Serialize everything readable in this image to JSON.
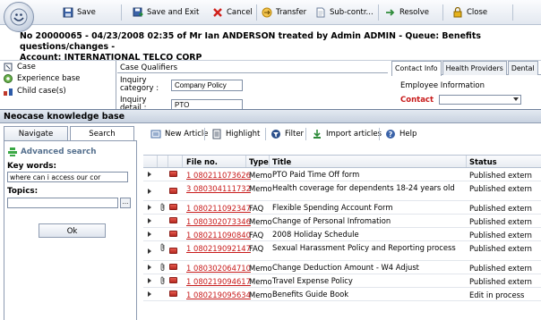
{
  "toolbar": {
    "save": "Save",
    "save_exit": "Save and Exit",
    "cancel": "Cancel",
    "transfer": "Transfer",
    "subcontr": "Sub-contr...",
    "resolve": "Resolve",
    "close": "Close"
  },
  "header": {
    "line1": "No 20000065 - 04/23/2008 02:35 of Mr Ian ANDERSON treated by Admin ADMIN - Queue: Benefits questions/changes -",
    "line2": "Account: INTERNATIONAL TELCO CORP"
  },
  "case_nav": [
    "Case",
    "Experience base",
    "Child case(s)"
  ],
  "qualifiers": {
    "title": "Case Qualifiers",
    "inquiry_category_label": "Inquiry category :",
    "inquiry_category_value": "Company Policy",
    "inquiry_detail_label": "Inquiry detail :",
    "inquiry_detail_value": "PTO"
  },
  "contact_panel": {
    "tabs": [
      "Contact Info",
      "Health Providers",
      "Dental"
    ],
    "section": "Employee Information",
    "contact_label": "Contact"
  },
  "kb": {
    "title": "Neocase knowledge base",
    "tabs": {
      "navigate": "Navigate",
      "search": "Search"
    },
    "advanced_search": "Advanced search",
    "keywords_label": "Key words:",
    "keywords_value": "where can i access our cor",
    "topics_label": "Topics:",
    "topics_btn": "...",
    "ok": "Ok"
  },
  "grid_toolbar": {
    "new_article": "New Article",
    "highlight": "Highlight",
    "filter": "Filter",
    "import": "Import articles",
    "help": "Help"
  },
  "columns": {
    "file_no": "File no.",
    "type": "Type",
    "title": "Title",
    "status": "Status"
  },
  "rows": [
    {
      "file_no": "1 080211073626",
      "type": "Memo",
      "title": "PTO Paid Time Off form",
      "status": "Published extern",
      "attach": false
    },
    {
      "file_no": "3 080304111732",
      "type": "Memo",
      "title": "Health coverage for dependents 18-24 years old",
      "status": "Published extern",
      "attach": false
    },
    {
      "file_no": "1 080211092347",
      "type": "FAQ",
      "title": "Flexible Spending Account Form",
      "status": "Published extern",
      "attach": true
    },
    {
      "file_no": "1 080302073346",
      "type": "Memo",
      "title": "Change of Personal Infromation",
      "status": "Published extern",
      "attach": false
    },
    {
      "file_no": "1 080211090840",
      "type": "FAQ",
      "title": "2008 Holiday Schedule",
      "status": "Published extern",
      "attach": false
    },
    {
      "file_no": "1 080219092147",
      "type": "FAQ",
      "title": "Sexual Harassment Policy and Reporting process",
      "status": "Published extern",
      "attach": true
    },
    {
      "file_no": "1 080302064710",
      "type": "Memo",
      "title": "Change Deduction Amount - W4 Adjust",
      "status": "Published extern",
      "attach": true
    },
    {
      "file_no": "1 080219094617",
      "type": "Memo",
      "title": "Travel Expense Policy",
      "status": "Published extern",
      "attach": true
    },
    {
      "file_no": "1 080219095634",
      "type": "Memo",
      "title": "Benefits Guide Book",
      "status": "Edit in process",
      "attach": false
    }
  ],
  "colors": {
    "link_red": "#c81b1b",
    "accent_blue": "#55708e"
  }
}
